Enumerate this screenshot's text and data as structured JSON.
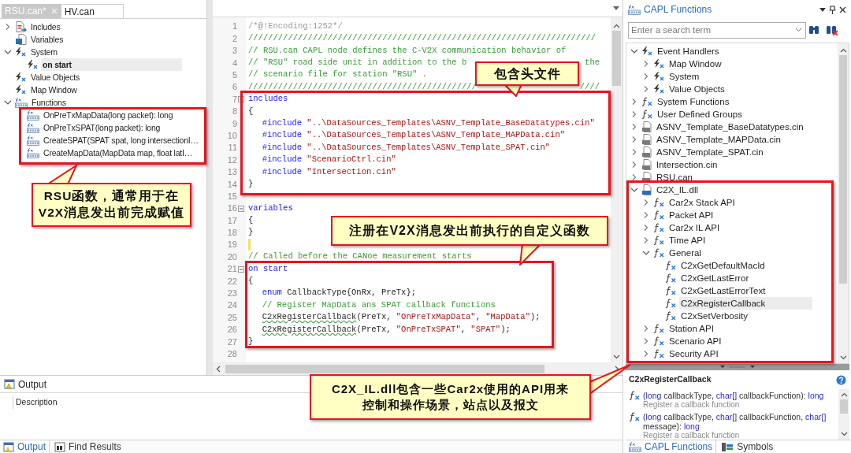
{
  "file_tabs": [
    {
      "label": "RSU.can*",
      "selected": true,
      "closable": true
    },
    {
      "label": "HV.can",
      "selected": false,
      "closable": false
    }
  ],
  "node_tree": [
    {
      "kind": "includes",
      "label": "Includes",
      "expanded": false,
      "selected": false
    },
    {
      "kind": "variables",
      "label": "Variables",
      "selected": false
    },
    {
      "kind": "handler",
      "label": "System",
      "expanded": true,
      "selected": false,
      "children": [
        {
          "kind": "handler",
          "label": "on start",
          "selected": true
        }
      ]
    },
    {
      "kind": "handler",
      "label": "Value Objects",
      "selected": false
    },
    {
      "kind": "handler",
      "label": "Map Window",
      "selected": false
    },
    {
      "kind": "capl",
      "label": "Functions",
      "expanded": true,
      "selected": false,
      "children": [
        {
          "kind": "capl",
          "label": "OnPreTxMapData(long packet): long",
          "selected": false
        },
        {
          "kind": "capl",
          "label": "OnPreTxSPAT(long packet): long",
          "selected": false
        },
        {
          "kind": "capl",
          "label": "CreateSPAT(SPAT spat, long intersectionI…",
          "selected": false
        },
        {
          "kind": "capl",
          "label": "CreateMapData(MapData map, float latI…",
          "selected": false
        }
      ]
    }
  ],
  "code_lines": [
    {
      "n": "1",
      "tokens": [
        {
          "kind": "meta",
          "text": "/*@!Encoding:1252*/"
        }
      ]
    },
    {
      "n": "2",
      "tokens": [
        {
          "kind": "comment",
          "text": "//////////////////////////////////////////////////////////////////////"
        }
      ]
    },
    {
      "n": "3",
      "tokens": [
        {
          "kind": "comment",
          "text": "// RSU.can CAPL node defines the C-V2X communication behavior of"
        }
      ]
    },
    {
      "n": "4",
      "tokens": [
        {
          "kind": "comment",
          "text": "// \"RSU\" road side unit in addition to the b"
        }
      ],
      "tail": "the"
    },
    {
      "n": "5",
      "tokens": [
        {
          "kind": "comment",
          "text": "// scenario file for station \"RSU\" ."
        }
      ]
    },
    {
      "n": "6",
      "tokens": [
        {
          "kind": "comment",
          "text": "//////////////////////////////////////////////"
        }
      ],
      "tail": "////"
    },
    {
      "n": "7",
      "fold": true,
      "tokens": [
        {
          "kind": "keyword",
          "text": "includes"
        }
      ]
    },
    {
      "n": "8",
      "tokens": [
        {
          "kind": "plain",
          "text": "{"
        }
      ]
    },
    {
      "n": "9",
      "indented": true,
      "tokens": [
        {
          "kind": "directive",
          "text": "#include"
        },
        {
          "kind": "string",
          "text": "\"..\\DataSources_Templates\\ASNV_Template_BaseDatatypes.cin\""
        }
      ]
    },
    {
      "n": "10",
      "indented": true,
      "tokens": [
        {
          "kind": "directive",
          "text": "#include"
        },
        {
          "kind": "string",
          "text": "\"..\\DataSources_Templates\\ASNV_Template_MAPData.cin\""
        }
      ]
    },
    {
      "n": "11",
      "indented": true,
      "tokens": [
        {
          "kind": "directive",
          "text": "#include"
        },
        {
          "kind": "string",
          "text": "\"..\\DataSources_Templates\\ASNV_Template_SPAT.cin\""
        }
      ]
    },
    {
      "n": "12",
      "indented": true,
      "tokens": [
        {
          "kind": "directive",
          "text": "#include"
        },
        {
          "kind": "string",
          "text": "\"ScenarioCtrl.cin\""
        }
      ]
    },
    {
      "n": "13",
      "indented": true,
      "tokens": [
        {
          "kind": "directive",
          "text": "#include"
        },
        {
          "kind": "string",
          "text": "\"Intersection.cin\""
        }
      ]
    },
    {
      "n": "14",
      "tokens": [
        {
          "kind": "plain",
          "text": "}"
        }
      ]
    },
    {
      "n": "15"
    },
    {
      "n": "16",
      "fold": true,
      "tokens": [
        {
          "kind": "keyword",
          "text": "variables"
        }
      ]
    },
    {
      "n": "17",
      "tokens": [
        {
          "kind": "plain",
          "text": "{"
        }
      ]
    },
    {
      "n": "18",
      "tokens": [
        {
          "kind": "plain",
          "text": "}"
        }
      ]
    },
    {
      "n": "19",
      "modified": true
    },
    {
      "n": "20",
      "tokens": [
        {
          "kind": "comment",
          "text": "// Called before the CANoe measurement starts"
        }
      ]
    },
    {
      "n": "21",
      "fold": true,
      "tokens": [
        {
          "kind": "keyword",
          "text": "on start"
        }
      ]
    },
    {
      "n": "22",
      "tokens": [
        {
          "kind": "plain",
          "text": "{"
        }
      ]
    },
    {
      "n": "23",
      "indented": true,
      "tokens": [
        {
          "kind": "keyword",
          "text": "enum"
        },
        {
          "kind": "plain",
          "text": " CallbackType{OnRx, PreTx};"
        }
      ]
    },
    {
      "n": "24",
      "indented": true,
      "tokens": [
        {
          "kind": "comment",
          "text": "// Register MapData ans SPAT callback functions"
        }
      ]
    },
    {
      "n": "25",
      "indented": true,
      "tokens": [
        {
          "kind": "call",
          "text": "C2xRegisterCallback"
        },
        {
          "kind": "plain",
          "text": "(PreTx, "
        },
        {
          "kind": "string",
          "text": "\"OnPreTxMapData\""
        },
        {
          "kind": "plain",
          "text": ", "
        },
        {
          "kind": "string",
          "text": "\"MapData\""
        },
        {
          "kind": "plain",
          "text": ");"
        }
      ]
    },
    {
      "n": "26",
      "indented": true,
      "tokens": [
        {
          "kind": "call",
          "text": "C2xRegisterCallback"
        },
        {
          "kind": "plain",
          "text": "(PreTx, "
        },
        {
          "kind": "string",
          "text": "\"OnPreTxSPAT\""
        },
        {
          "kind": "plain",
          "text": ", "
        },
        {
          "kind": "string",
          "text": "\"SPAT\""
        },
        {
          "kind": "plain",
          "text": ");"
        }
      ]
    },
    {
      "n": "27",
      "tokens": [
        {
          "kind": "plain",
          "text": "}"
        }
      ]
    },
    {
      "n": "28"
    }
  ],
  "output": {
    "title": "Output",
    "column": "Description"
  },
  "bottom_tabs": [
    {
      "label": "Output",
      "selected": true
    },
    {
      "label": "Find Results",
      "selected": false
    }
  ],
  "capl_panel": {
    "title": "CAPL Functions",
    "search": {
      "placeholder": "Enter a search term"
    },
    "tree": [
      {
        "kind": "handler",
        "label": "Event Handlers",
        "expanded": true,
        "selected": false,
        "children": [
          {
            "kind": "handler",
            "label": "Map Window",
            "expanded": false,
            "selected": false
          },
          {
            "kind": "handler",
            "label": "System",
            "expanded": false,
            "selected": false
          },
          {
            "kind": "handler",
            "label": "Value Objects",
            "expanded": false,
            "selected": false
          }
        ]
      },
      {
        "kind": "fx",
        "label": "System Functions",
        "expanded": false,
        "selected": false
      },
      {
        "kind": "fx",
        "label": "User Defined Groups",
        "expanded": false,
        "selected": false
      },
      {
        "kind": "file",
        "label": "ASNV_Template_BaseDatatypes.cin",
        "expanded": false,
        "selected": false
      },
      {
        "kind": "file",
        "label": "ASNV_Template_MAPData.cin",
        "expanded": false,
        "selected": false
      },
      {
        "kind": "file",
        "label": "ASNV_Template_SPAT.cin",
        "expanded": false,
        "selected": false
      },
      {
        "kind": "file",
        "label": "Intersection.cin",
        "expanded": false,
        "selected": false
      },
      {
        "kind": "file",
        "label": "RSU.can",
        "expanded": false,
        "selected": false
      },
      {
        "kind": "dll",
        "label": "C2X_IL.dll",
        "expanded": true,
        "selected": false,
        "children": [
          {
            "kind": "fx",
            "label": "Car2x Stack API",
            "expanded": false,
            "selected": false
          },
          {
            "kind": "fx",
            "label": "Packet API",
            "expanded": false,
            "selected": false
          },
          {
            "kind": "fx",
            "label": "Car2x IL API",
            "expanded": false,
            "selected": false
          },
          {
            "kind": "fx",
            "label": "Time API",
            "expanded": false,
            "selected": false
          },
          {
            "kind": "fx",
            "label": "General",
            "expanded": true,
            "selected": false,
            "children": [
              {
                "kind": "fx",
                "label": "C2xGetDefaultMacId",
                "selected": false
              },
              {
                "kind": "fx",
                "label": "C2xGetLastError",
                "selected": false
              },
              {
                "kind": "fx",
                "label": "C2xGetLastErrorText",
                "selected": false
              },
              {
                "kind": "fx",
                "label": "C2xRegisterCallback",
                "selected": true
              },
              {
                "kind": "fx",
                "label": "C2xSetVerbosity",
                "selected": false
              }
            ]
          },
          {
            "kind": "fx",
            "label": "Station API",
            "expanded": false,
            "selected": false
          },
          {
            "kind": "fx",
            "label": "Scenario API",
            "expanded": false,
            "selected": false
          },
          {
            "kind": "fx",
            "label": "Security API",
            "expanded": false,
            "selected": false
          }
        ]
      }
    ],
    "help": {
      "title": "C2xRegisterCallback",
      "overloads": [
        {
          "tokens": [
            {
              "kind": "plain",
              "text": "("
            },
            {
              "kind": "type",
              "text": "long"
            },
            {
              "kind": "plain",
              "text": " callbackType, "
            },
            {
              "kind": "type",
              "text": "char[]"
            },
            {
              "kind": "plain",
              "text": " callbackFunction): "
            },
            {
              "kind": "type",
              "text": "long"
            }
          ],
          "description": "Register a callback function"
        },
        {
          "tokens": [
            {
              "kind": "plain",
              "text": "("
            },
            {
              "kind": "type",
              "text": "long"
            },
            {
              "kind": "plain",
              "text": " callbackType, "
            },
            {
              "kind": "type",
              "text": "char[]"
            },
            {
              "kind": "plain",
              "text": " callbackFunction, "
            },
            {
              "kind": "type",
              "text": "char[]"
            },
            {
              "kind": "plain",
              "text": " message): "
            },
            {
              "kind": "type",
              "text": "long"
            }
          ],
          "description": "Register a callback function"
        }
      ]
    },
    "tabs": [
      {
        "label": "CAPL Functions",
        "selected": true,
        "kind": "capl"
      },
      {
        "label": "Symbols",
        "selected": false,
        "kind": "symbols"
      }
    ]
  },
  "callouts": [
    {
      "lines": [
        "包含头文件"
      ]
    },
    {
      "lines": [
        "RSU函数，通常用于在",
        "V2X消息发出前完成赋值"
      ]
    },
    {
      "lines": [
        "注册在V2X消息发出前执行的自定义函数"
      ]
    },
    {
      "lines": [
        "C2X_IL.dll包含一些Car2x使用的API用来",
        "控制和操作场景，站点以及报文"
      ]
    }
  ]
}
